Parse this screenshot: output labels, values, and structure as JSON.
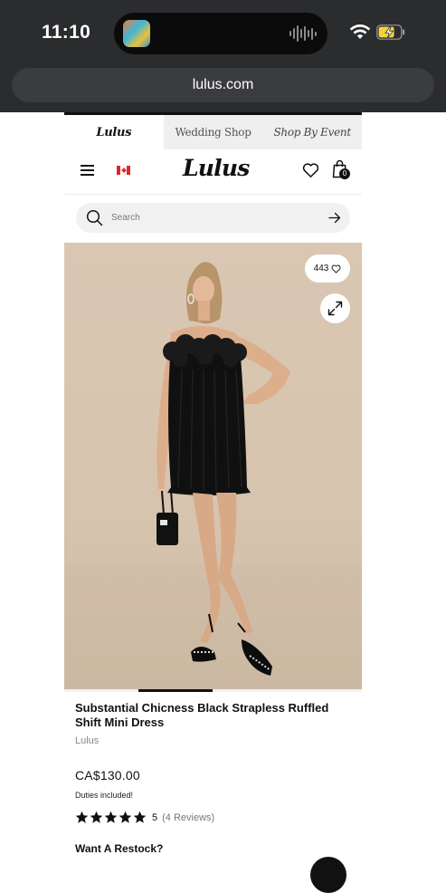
{
  "status_bar": {
    "time": "11:10",
    "island_app_icon": "music-app-icon",
    "island_activity_icon": "audio-waveform-icon",
    "wifi_icon": "wifi-icon",
    "battery_icon": "battery-charging-icon",
    "battery_color": "#f2d43a"
  },
  "browser": {
    "url": "lulus.com"
  },
  "site": {
    "brand_tabs": [
      {
        "label": "Lulus"
      },
      {
        "label": "Wedding Shop"
      },
      {
        "label": "Shop By Event"
      }
    ],
    "logo": "Lulus",
    "cart_count": "0",
    "icons": {
      "menu": "hamburger-menu-icon",
      "flag": "canada-flag-icon",
      "wishlist": "heart-icon",
      "cart": "shopping-bag-icon"
    }
  },
  "search": {
    "placeholder": "Search"
  },
  "gallery": {
    "like_count": "443",
    "active_image_index": 2,
    "image_count": 4
  },
  "product": {
    "title": "Substantial Chicness Black Strapless Ruffled Shift Mini Dress",
    "brand": "Lulus",
    "price": "CA$130.00",
    "duties_note": "Duties included!",
    "rating_value": "5",
    "rating_stars": 5,
    "reviews_label": "(4 Reviews)",
    "restock_heading": "Want A Restock?"
  },
  "colors": {
    "status_bar_bg": "#2b2c2e",
    "url_bar_bg": "#3b3c3f",
    "photo_bg": "#d8c6b1",
    "text_primary": "#111111",
    "text_muted": "#888888"
  }
}
